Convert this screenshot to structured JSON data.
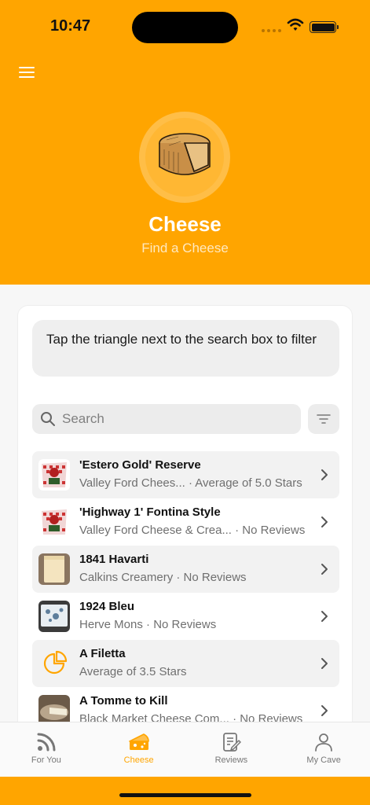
{
  "status": {
    "time": "10:47"
  },
  "header": {
    "title": "Cheese",
    "subtitle": "Find a Cheese"
  },
  "tip": {
    "text": "Tap the triangle next to the search box to filter"
  },
  "search": {
    "placeholder": "Search"
  },
  "colors": {
    "brand": "#FFA500",
    "background": "#f7f7f7"
  },
  "cheeses": [
    {
      "name": "'Estero Gold' Reserve",
      "subtitle": "Valley Ford Chees... · Average of 5.0 Stars",
      "thumb": "package-red"
    },
    {
      "name": "'Highway 1' Fontina Style",
      "subtitle": "Valley Ford Cheese & Crea... · No Reviews",
      "thumb": "package-red"
    },
    {
      "name": "1841 Havarti",
      "subtitle": "Calkins Creamery · No Reviews",
      "thumb": "havarti-block"
    },
    {
      "name": "1924 Bleu",
      "subtitle": "Herve Mons · No Reviews",
      "thumb": "blue-cheese"
    },
    {
      "name": "A Filetta",
      "subtitle": "Average of 3.5 Stars",
      "thumb": "cheese-wedge-icon"
    },
    {
      "name": "A Tomme to Kill",
      "subtitle": "Black Market Cheese Com... · No Reviews",
      "thumb": "tomme-wheel"
    }
  ],
  "tabs": [
    {
      "label": "For You",
      "icon": "rss-feed-icon",
      "active": false
    },
    {
      "label": "Cheese",
      "icon": "cheese-icon",
      "active": true
    },
    {
      "label": "Reviews",
      "icon": "reviews-icon",
      "active": false
    },
    {
      "label": "My Cave",
      "icon": "person-icon",
      "active": false
    }
  ]
}
